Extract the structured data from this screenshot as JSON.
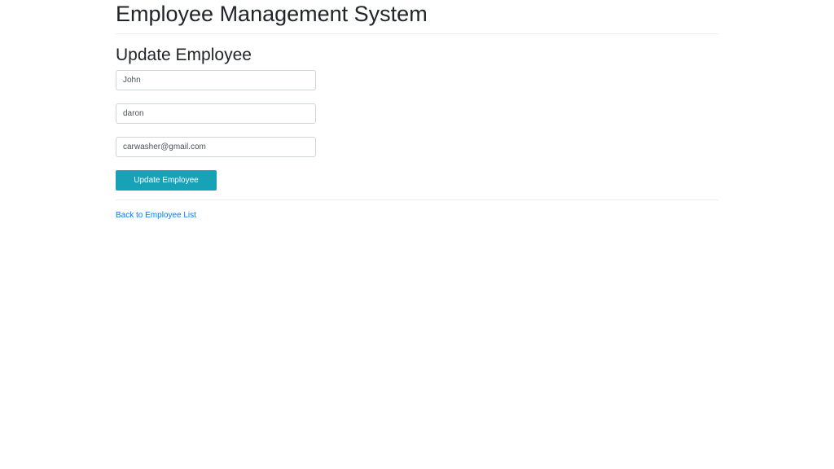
{
  "header": {
    "title": "Employee Management System"
  },
  "form": {
    "title": "Update Employee",
    "first_name": "John",
    "last_name": "daron",
    "email": "carwasher@gmail.com",
    "submit_label": "Update Employee"
  },
  "footer": {
    "back_link": "Back to Employee List"
  },
  "colors": {
    "button": "#17a2b8",
    "link": "#007bff"
  }
}
